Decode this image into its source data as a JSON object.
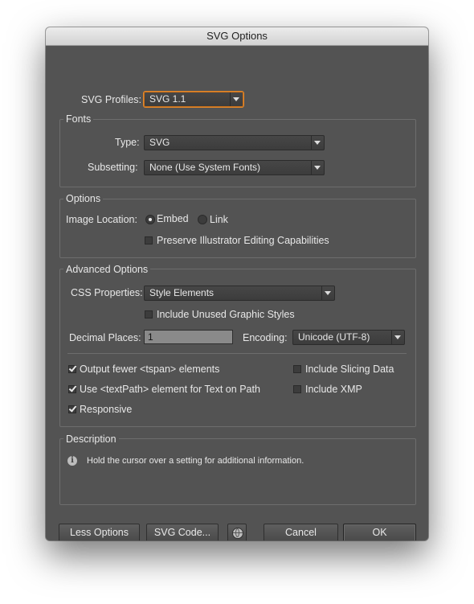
{
  "window": {
    "title": "SVG Options"
  },
  "profiles": {
    "label": "SVG Profiles:",
    "value": "SVG 1.1"
  },
  "fonts": {
    "legend": "Fonts",
    "type_label": "Type:",
    "type_value": "SVG",
    "subsetting_label": "Subsetting:",
    "subsetting_value": "None (Use System Fonts)"
  },
  "options": {
    "legend": "Options",
    "image_location_label": "Image Location:",
    "embed_label": "Embed",
    "embed_selected": true,
    "link_label": "Link",
    "link_selected": false,
    "preserve_label": "Preserve Illustrator Editing Capabilities",
    "preserve_checked": false
  },
  "advanced": {
    "legend": "Advanced Options",
    "css_label": "CSS Properties:",
    "css_value": "Style Elements",
    "unused_styles_label": "Include Unused Graphic Styles",
    "unused_styles_checked": false,
    "decimal_label": "Decimal Places:",
    "decimal_value": "1",
    "encoding_label": "Encoding:",
    "encoding_value": "Unicode (UTF-8)",
    "checkboxes": {
      "fewer_tspan": {
        "label": "Output fewer <tspan> elements",
        "checked": true
      },
      "textpath": {
        "label": "Use <textPath> element for Text on Path",
        "checked": true
      },
      "responsive": {
        "label": "Responsive",
        "checked": true
      },
      "slicing": {
        "label": "Include Slicing Data",
        "checked": false
      },
      "xmp": {
        "label": "Include XMP",
        "checked": false
      }
    }
  },
  "description": {
    "legend": "Description",
    "text": "Hold the cursor over a setting for additional information.",
    "icon": "info-icon"
  },
  "buttons": {
    "less_options": "Less Options",
    "svg_code": "SVG Code...",
    "web_icon": "globe-icon",
    "cancel": "Cancel",
    "ok": "OK"
  },
  "colors": {
    "dialog_bg": "#535353",
    "focus_ring": "#e2892c",
    "field_bg": "#3c3c3c"
  }
}
